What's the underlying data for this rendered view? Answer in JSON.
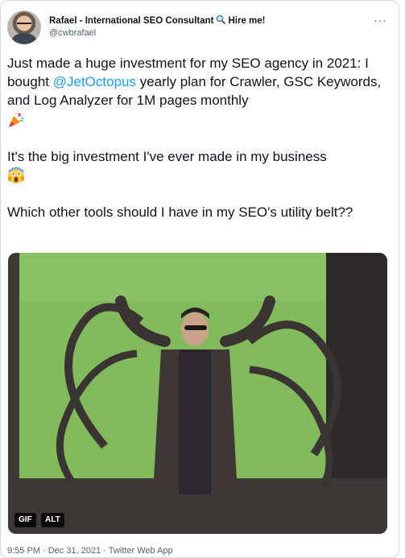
{
  "author": {
    "display_name": "Rafael - International SEO Consultant",
    "name_suffix": "Hire me!",
    "handle": "@cwbrafael",
    "more_label": "···"
  },
  "tweet": {
    "line1_before": "Just made a huge investment for my SEO agency in 2021: I bought ",
    "mention": "@JetOctopus",
    "line1_after": " yearly plan for Crawler, GSC Keywords, and Log Analyzer for 1M pages monthly",
    "paragraph2": "It's the big investment I've ever made in my business",
    "paragraph3": "Which other tools should I have in my SEO's utility belt??"
  },
  "media": {
    "gif_label": "GIF",
    "alt_label": "ALT"
  },
  "footer": {
    "timestamp": "9:55 PM · Dec 31, 2021 · Twitter Web App"
  },
  "icons": [
    "magnifier-icon",
    "party-popper-icon",
    "scream-face-icon",
    "more-icon"
  ],
  "colors": {
    "mention": "#1d9bf0",
    "secondary_text": "#536471",
    "green_screen": "#7fb95a"
  }
}
